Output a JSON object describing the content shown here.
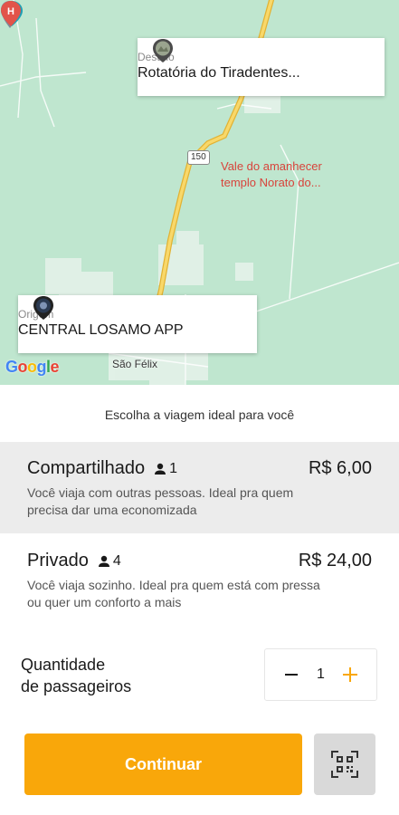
{
  "map": {
    "road_number": "150",
    "poi_name_line1": "Vale do amanhecer",
    "poi_name_line2": "templo Norato do...",
    "town": "São Félix",
    "google": "Google"
  },
  "destination": {
    "caption": "Destino",
    "value": "Rotatória do Tiradentes..."
  },
  "origin": {
    "caption": "Origem",
    "value": "CENTRAL LOSAMO APP"
  },
  "subtitle": "Escolha a viagem ideal para você",
  "options": [
    {
      "name": "Compartilhado",
      "seats": "1",
      "price": "R$ 6,00",
      "desc_line1": "Você viaja com outras pessoas. Ideal pra quem",
      "desc_line2": "precisa dar uma economizada",
      "selected": true
    },
    {
      "name": "Privado",
      "seats": "4",
      "price": "R$ 24,00",
      "desc_line1": "Você viaja sozinho. Ideal pra quem está com pressa",
      "desc_line2": "ou quer um conforto a mais",
      "selected": false
    }
  ],
  "quantity": {
    "label_line1": "Quantidade",
    "label_line2": "de passageiros",
    "value": "1"
  },
  "continue_label": "Continuar",
  "colors": {
    "accent": "#f9a70a",
    "map_bg": "#bfe6cf",
    "road": "#f5c84b",
    "poi": "#d8433b"
  },
  "icons": [
    "map-pin-icon",
    "hospital-icon",
    "person-icon",
    "minus-icon",
    "plus-icon",
    "qr-scan-icon"
  ]
}
